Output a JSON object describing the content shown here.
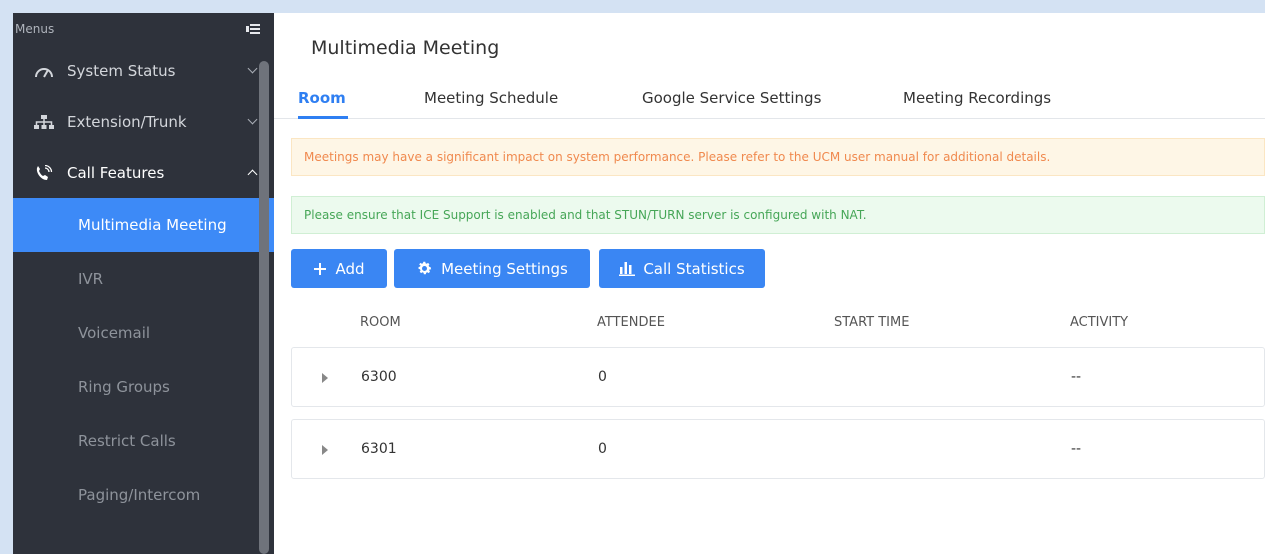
{
  "sidebar": {
    "header": "Menus",
    "groups": [
      {
        "label": "System Status",
        "icon": "gauge-icon",
        "open": false
      },
      {
        "label": "Extension/Trunk",
        "icon": "network-icon",
        "open": false
      },
      {
        "label": "Call Features",
        "icon": "phone-icon",
        "open": true
      }
    ],
    "items": [
      {
        "label": "Multimedia Meeting",
        "active": true
      },
      {
        "label": "IVR",
        "active": false
      },
      {
        "label": "Voicemail",
        "active": false
      },
      {
        "label": "Ring Groups",
        "active": false
      },
      {
        "label": "Restrict Calls",
        "active": false
      },
      {
        "label": "Paging/Intercom",
        "active": false
      }
    ]
  },
  "main": {
    "title": "Multimedia Meeting",
    "tabs": [
      {
        "label": "Room",
        "active": true
      },
      {
        "label": "Meeting Schedule",
        "active": false
      },
      {
        "label": "Google Service Settings",
        "active": false
      },
      {
        "label": "Meeting Recordings",
        "active": false
      }
    ],
    "alerts": {
      "warning": "Meetings may have a significant impact on system performance. Please refer to the UCM user manual for additional details.",
      "info": "Please ensure that ICE Support is enabled and that STUN/TURN server is configured with NAT."
    },
    "buttons": {
      "add": "Add",
      "meeting_settings": "Meeting Settings",
      "call_statistics": "Call Statistics"
    },
    "table": {
      "columns": [
        "ROOM",
        "ATTENDEE",
        "START TIME",
        "ACTIVITY"
      ],
      "rows": [
        {
          "room": "6300",
          "attendee": "0",
          "start_time": "",
          "activity": "--"
        },
        {
          "room": "6301",
          "attendee": "0",
          "start_time": "",
          "activity": "--"
        }
      ]
    }
  },
  "colors": {
    "sidebar_bg": "#2e323b",
    "accent": "#3a86f3",
    "warning_text": "#f0894e",
    "info_text": "#46a657"
  }
}
